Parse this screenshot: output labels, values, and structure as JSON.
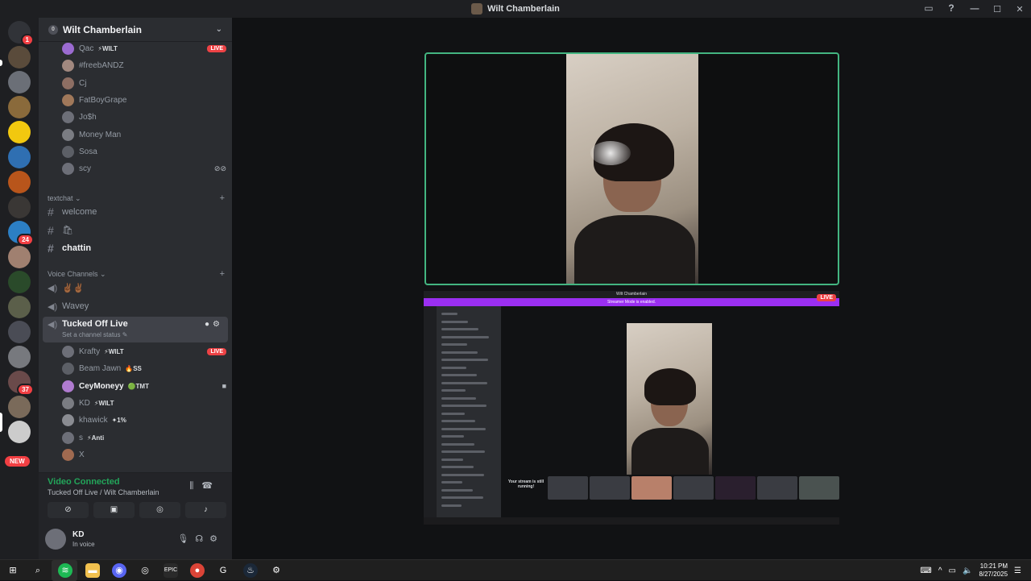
{
  "window": {
    "title": "Wilt Chamberlain"
  },
  "rail": {
    "servers": [
      {
        "name": "home",
        "color": "#313338",
        "badge": "1"
      },
      {
        "name": "server-2",
        "color": "#5a4b3b",
        "badge": ""
      },
      {
        "name": "server-3",
        "color": "#6b6f77",
        "badge": ""
      },
      {
        "name": "server-4",
        "color": "#8a6a3b",
        "badge": ""
      },
      {
        "name": "server-5",
        "color": "#f2c80f",
        "badge": ""
      },
      {
        "name": "server-6",
        "color": "#2f6fb2",
        "badge": ""
      },
      {
        "name": "server-7",
        "color": "#b8551b",
        "badge": ""
      },
      {
        "name": "server-8",
        "color": "#3a3735",
        "badge": ""
      },
      {
        "name": "server-9",
        "color": "#2c7fc4",
        "badge": "24"
      },
      {
        "name": "server-10",
        "color": "#a08070",
        "badge": ""
      },
      {
        "name": "server-11",
        "color": "#2a4a2a",
        "badge": ""
      },
      {
        "name": "server-12",
        "color": "#5b5f4a",
        "badge": ""
      },
      {
        "name": "server-13",
        "color": "#4a4c55",
        "badge": ""
      },
      {
        "name": "server-14",
        "color": "#77797e",
        "badge": ""
      },
      {
        "name": "server-15",
        "color": "#6a4a4a",
        "badge": "37"
      },
      {
        "name": "server-16",
        "color": "#7a6a5a",
        "badge": ""
      },
      {
        "name": "server-17",
        "color": "#cccccc",
        "badge": ""
      }
    ],
    "new_label": "NEW"
  },
  "guild": {
    "name": "Wilt Chamberlain",
    "top_members": [
      {
        "name": "Qac",
        "tag": "⚡WILT",
        "live": "LIVE",
        "color": "#9b6bd1"
      },
      {
        "name": "#freebANDZ",
        "tag": "",
        "live": "",
        "color": "#a1887f"
      },
      {
        "name": "Cj",
        "tag": "",
        "live": "",
        "color": "#8d6e63"
      },
      {
        "name": "FatBoyGrape",
        "tag": "",
        "live": "",
        "color": "#a0785a"
      },
      {
        "name": "Jo$h",
        "tag": "",
        "live": "",
        "color": "#6d6f78"
      },
      {
        "name": "Money Man",
        "tag": "",
        "live": "",
        "color": "#7a7c82"
      },
      {
        "name": "Sosa",
        "tag": "",
        "live": "",
        "color": "#5c5f66"
      },
      {
        "name": "scy",
        "tag": "",
        "live": "",
        "color": "#6d6f78"
      }
    ],
    "text_category": "textchat",
    "text_channels": [
      {
        "name": "welcome",
        "bright": false
      },
      {
        "name": "🛍",
        "bright": false
      },
      {
        "name": "chattin",
        "bright": true
      }
    ],
    "voice_category": "Voice Channels",
    "voice_channels": [
      {
        "name": "✌🏾✌🏾"
      },
      {
        "name": "Wavey"
      }
    ],
    "active_voice": {
      "name": "Tucked Off Live",
      "status": "Set a channel status ✎"
    },
    "voice_members": [
      {
        "name": "Krafty",
        "tag": "⚡WILT",
        "live": "LIVE",
        "bright": false,
        "color": "#6d6f78"
      },
      {
        "name": "Beam Jawn",
        "tag": "🔥SS",
        "live": "",
        "bright": false,
        "color": "#5c5f66"
      },
      {
        "name": "CeyMoneyy",
        "tag": "🟢TMT",
        "live": "",
        "bright": true,
        "cam": "■",
        "color": "#b07bd0"
      },
      {
        "name": "KD",
        "tag": "⚡WILT",
        "live": "",
        "bright": false,
        "color": "#7a7c82"
      },
      {
        "name": "khawick",
        "tag": "✦1%",
        "live": "",
        "bright": false,
        "color": "#8a8c92"
      },
      {
        "name": "s",
        "tag": "⚡Anti",
        "live": "",
        "bright": false,
        "color": "#6d6f78"
      },
      {
        "name": "X",
        "tag": "",
        "live": "",
        "bright": false,
        "color": "#a06a50"
      }
    ]
  },
  "voice_panel": {
    "title": "Video Connected",
    "subtitle": "Tucked Off Live / Wilt Chamberlain"
  },
  "user": {
    "name": "KD",
    "status": "In voice"
  },
  "stream": {
    "banner": "Streamer Mode is enabled.",
    "live": "LIVE",
    "message": "Your stream is still running!"
  },
  "taskbar": {
    "time": "10:21 PM",
    "date": "8/27/2025"
  }
}
